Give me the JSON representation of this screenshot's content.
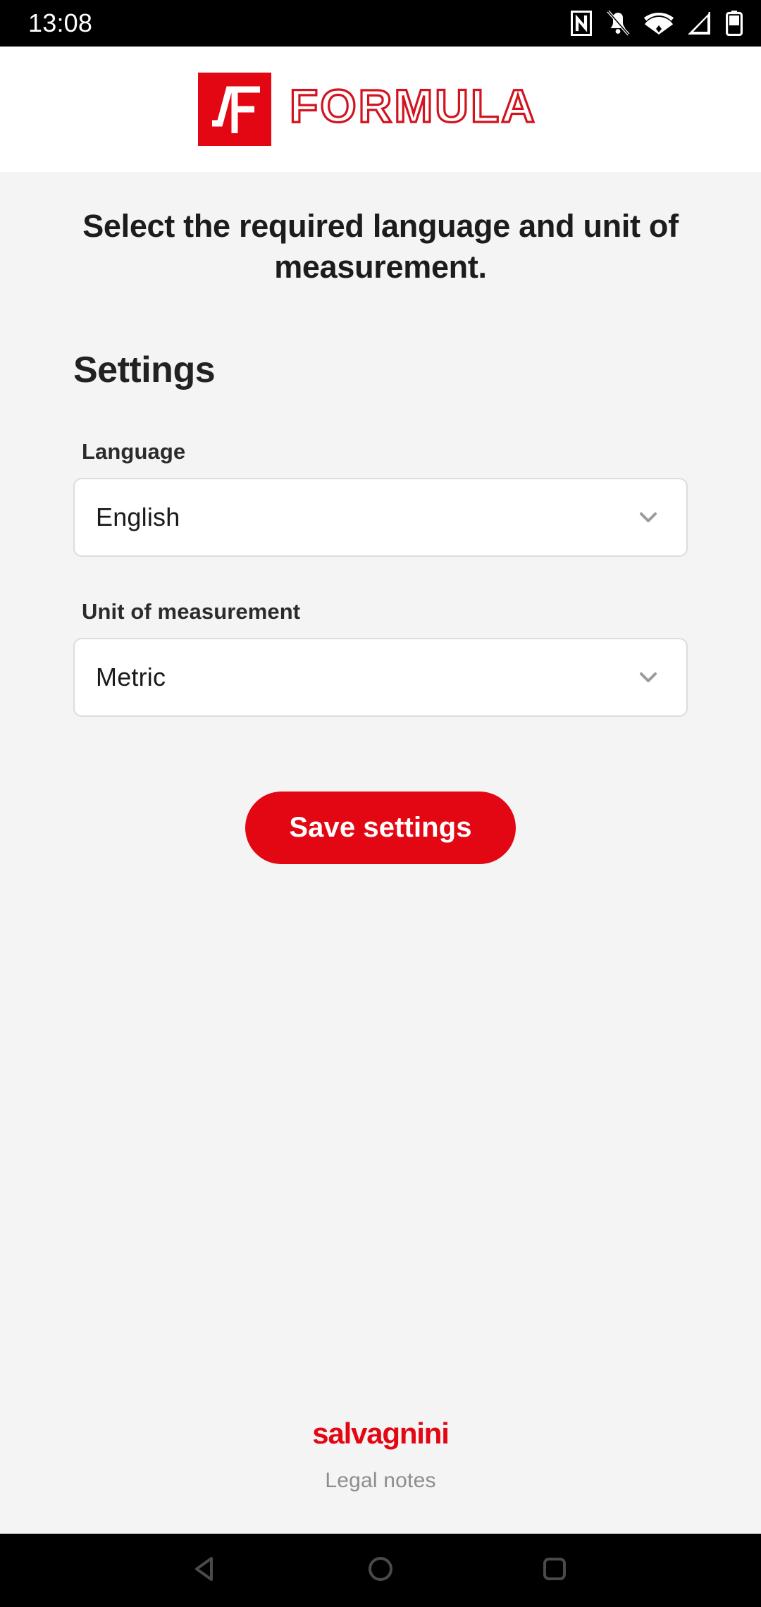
{
  "status_bar": {
    "time": "13:08",
    "icons": [
      {
        "name": "nfc-icon"
      },
      {
        "name": "notifications-muted-icon"
      },
      {
        "name": "wifi-icon"
      },
      {
        "name": "cellular-signal-icon"
      },
      {
        "name": "battery-icon"
      }
    ]
  },
  "header": {
    "logo_mark_alt": "formula-radical-f-mark",
    "brand_name": "FORMULA",
    "brand_color": "#e30613"
  },
  "main": {
    "intro": "Select the required language and unit of measurement.",
    "section_title": "Settings",
    "fields": [
      {
        "label": "Language",
        "value": "English",
        "dropdown_icon": "chevron-down-icon"
      },
      {
        "label": "Unit of measurement",
        "value": "Metric",
        "dropdown_icon": "chevron-down-icon"
      }
    ],
    "save_label": "Save settings"
  },
  "footer": {
    "company": "salvagnini",
    "legal_link": "Legal notes"
  },
  "nav_bar": {
    "back": "back-button",
    "home": "home-button",
    "recents": "recents-button"
  },
  "colors": {
    "brand_red": "#e30613",
    "page_bg": "#f4f4f4",
    "header_bg": "#ffffff",
    "system_bg": "#000000",
    "field_border": "#dcdcdc",
    "muted_text": "#8d8d8d"
  }
}
